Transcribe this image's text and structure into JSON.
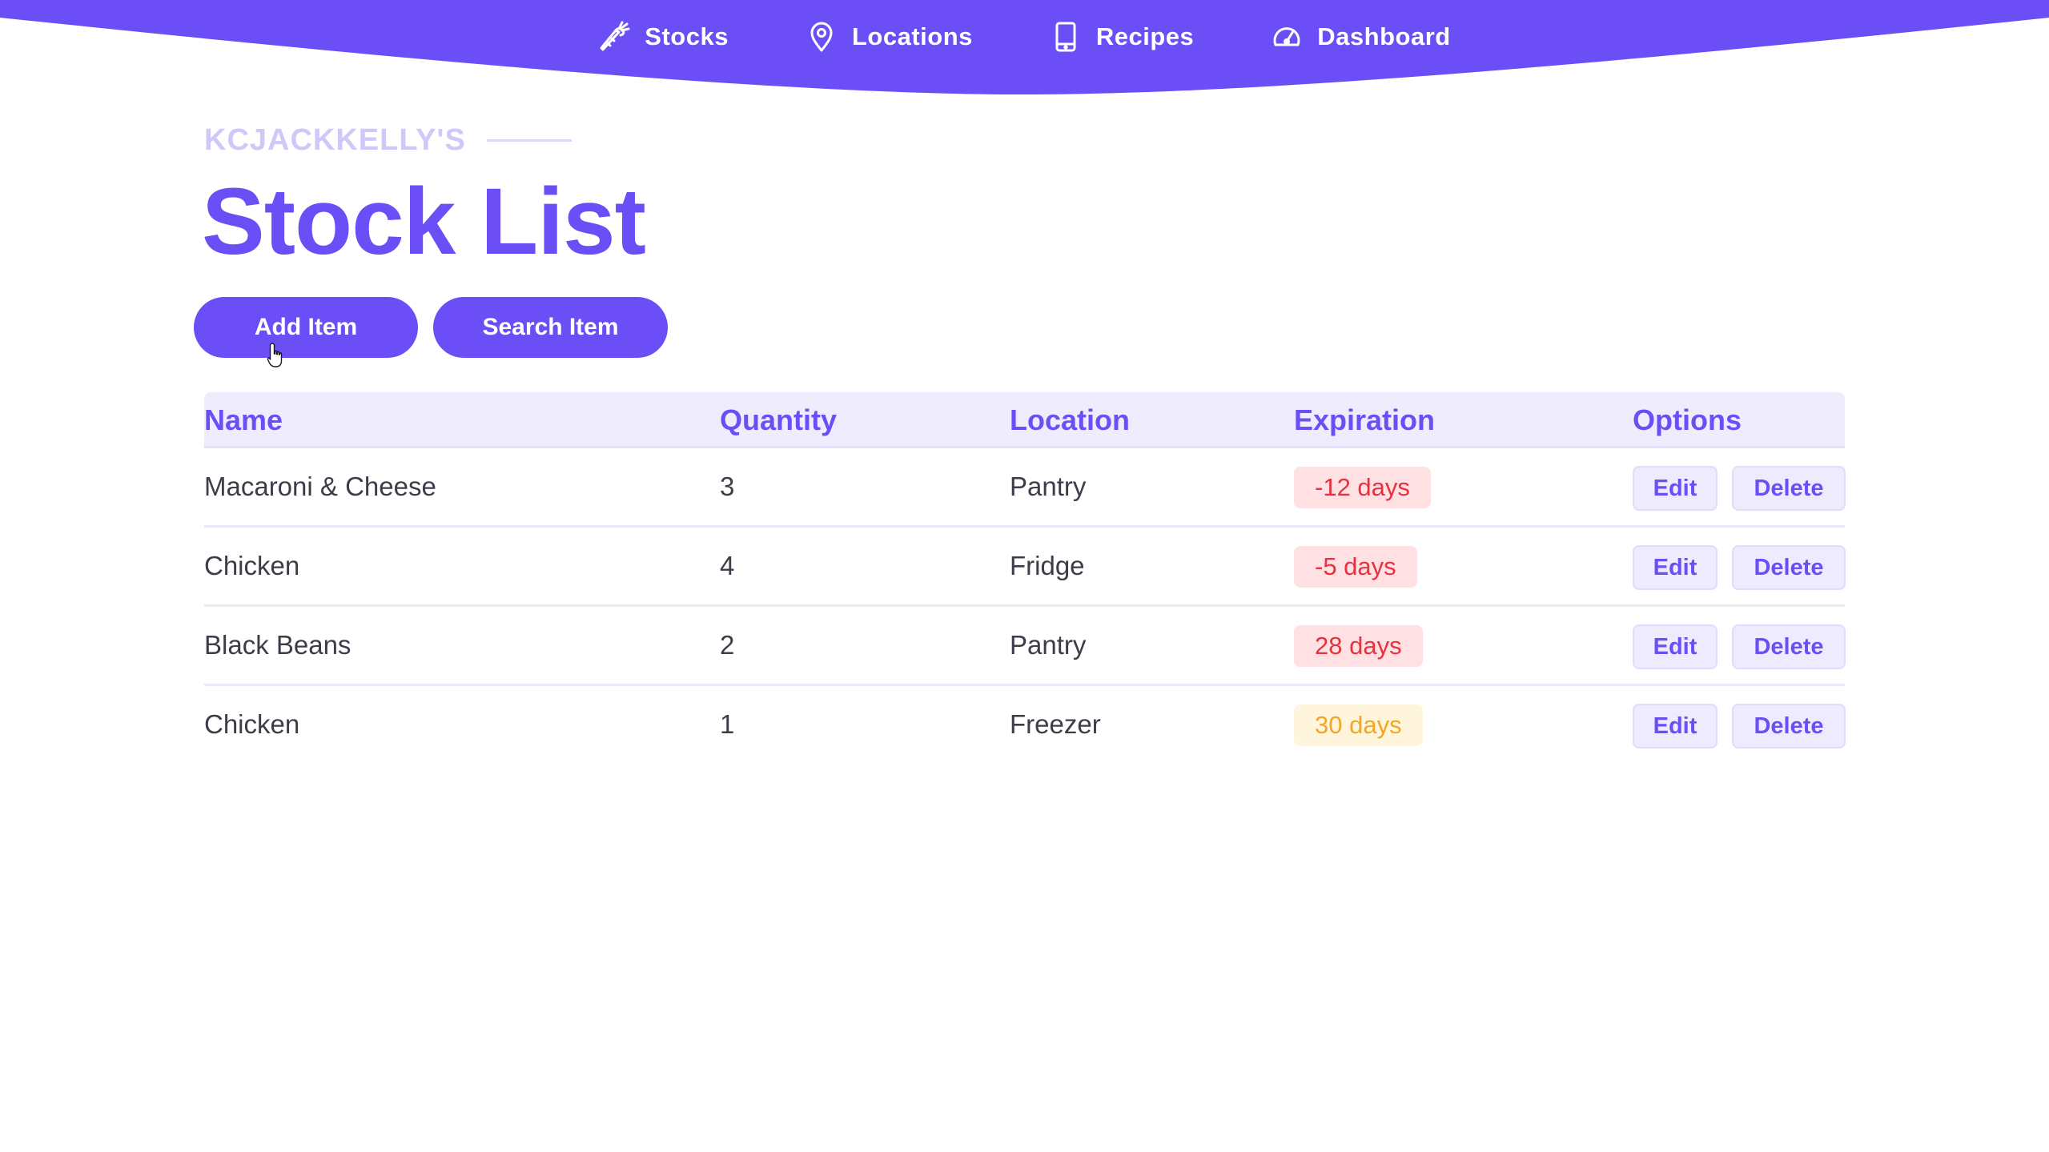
{
  "colors": {
    "brand": "#6b4ef5",
    "expired_badge_bg": "#ffe1e3",
    "expired_badge_text": "#e8313e",
    "warning_badge_bg": "#fff5dc",
    "warning_badge_text": "#f2a724"
  },
  "nav": {
    "items": [
      {
        "label": "Stocks",
        "icon": "carrot-icon"
      },
      {
        "label": "Locations",
        "icon": "map-pin-icon"
      },
      {
        "label": "Recipes",
        "icon": "tablet-icon"
      },
      {
        "label": "Dashboard",
        "icon": "speedometer-icon"
      }
    ]
  },
  "header": {
    "eyebrow": "KCJACKKELLY'S",
    "title": "Stock List"
  },
  "actions": {
    "add_label": "Add Item",
    "search_label": "Search Item"
  },
  "table": {
    "columns": [
      "Name",
      "Quantity",
      "Location",
      "Expiration",
      "Options"
    ],
    "rows": [
      {
        "name": "Macaroni & Cheese",
        "quantity": "3",
        "location": "Pantry",
        "expiration": "-12 days",
        "status": "expired"
      },
      {
        "name": "Chicken",
        "quantity": "4",
        "location": "Fridge",
        "expiration": "-5 days",
        "status": "expired"
      },
      {
        "name": "Black Beans",
        "quantity": "2",
        "location": "Pantry",
        "expiration": "28 days",
        "status": "expired"
      },
      {
        "name": "Chicken",
        "quantity": "1",
        "location": "Freezer",
        "expiration": "30 days",
        "status": "warning"
      }
    ],
    "edit_label": "Edit",
    "delete_label": "Delete"
  }
}
